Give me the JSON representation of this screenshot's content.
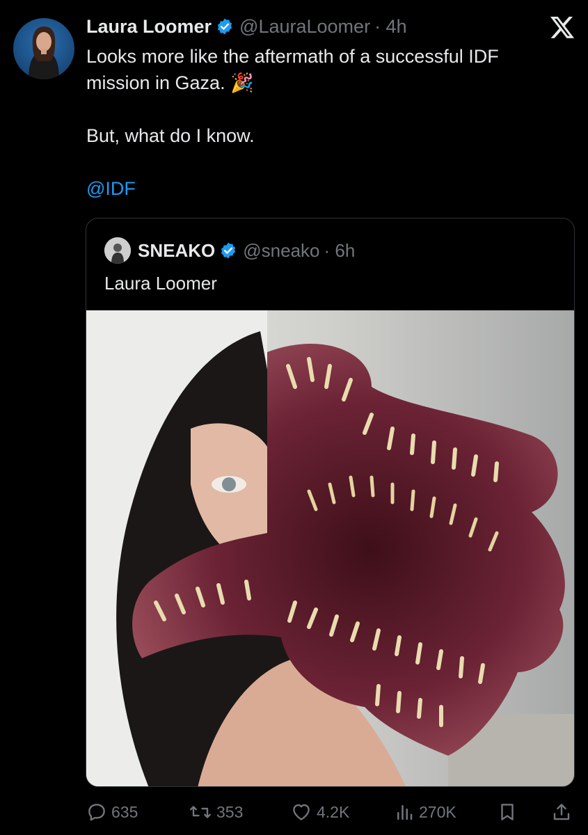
{
  "tweet": {
    "author_name": "Laura Loomer",
    "handle": "@LauraLoomer",
    "time": "· 4h",
    "lines": [
      "Looks more like the aftermath of a successful IDF",
      "mission in Gaza. 🎉",
      "",
      "But, what do I know.",
      "",
      "@IDF"
    ]
  },
  "quote": {
    "author_name": "SNEAKO",
    "handle": "@sneako",
    "time": "· 6h",
    "text": "Laura Loomer"
  },
  "actions": {
    "replies": "635",
    "retweets": "353",
    "likes": "4.2K",
    "views": "270K"
  },
  "icons": [
    "verified-badge-icon",
    "x-logo-icon",
    "reply-icon",
    "retweet-icon",
    "like-icon",
    "views-icon",
    "bookmark-icon",
    "share-icon"
  ],
  "colors": {
    "background": "#000000",
    "text": "#e7e9ea",
    "secondary": "#71767b",
    "link": "#1d9bf0",
    "badge": "#1d9bf0"
  }
}
